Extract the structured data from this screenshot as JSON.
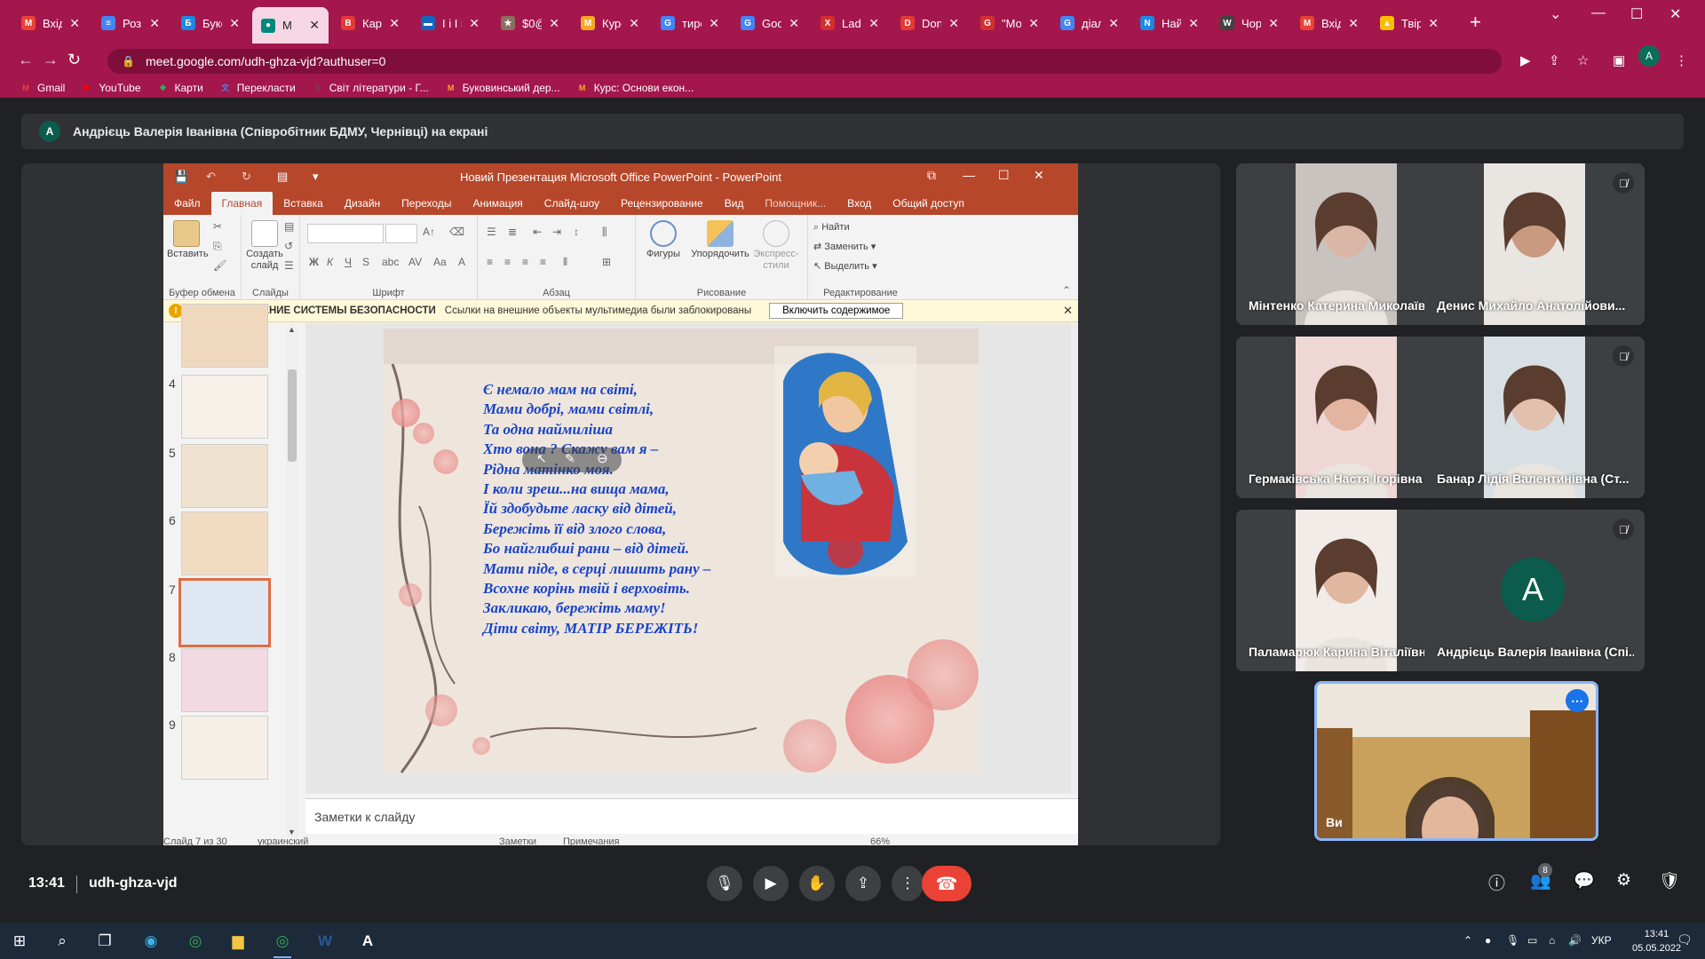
{
  "browser": {
    "tabs": [
      {
        "title": "Вхід",
        "color": "#ea4335",
        "glyph": "M"
      },
      {
        "title": "Розк",
        "color": "#4285f4",
        "glyph": "≡"
      },
      {
        "title": "Буко",
        "color": "#1e88e5",
        "glyph": "Б"
      },
      {
        "title": "M",
        "color": "#00897b",
        "glyph": "●",
        "active": true
      },
      {
        "title": "Карт",
        "color": "#e53935",
        "glyph": "В"
      },
      {
        "title": "І і І і",
        "color": "#1565c0",
        "glyph": "▬"
      },
      {
        "title": "$0@",
        "color": "#8d6e63",
        "glyph": "★"
      },
      {
        "title": "Курс",
        "color": "#f9a825",
        "glyph": "M"
      },
      {
        "title": "тире",
        "color": "#4285f4",
        "glyph": "G"
      },
      {
        "title": "Goo",
        "color": "#4285f4",
        "glyph": "G"
      },
      {
        "title": "Lady",
        "color": "#d32f2f",
        "glyph": "X"
      },
      {
        "title": "Don",
        "color": "#e53935",
        "glyph": "D"
      },
      {
        "title": "\"Мо",
        "color": "#d32f2f",
        "glyph": "G"
      },
      {
        "title": "діал",
        "color": "#4285f4",
        "glyph": "G"
      },
      {
        "title": "Найі",
        "color": "#1e88e5",
        "glyph": "N"
      },
      {
        "title": "Чорі",
        "color": "#424242",
        "glyph": "W"
      },
      {
        "title": "Вхід",
        "color": "#ea4335",
        "glyph": "M"
      },
      {
        "title": "Твір",
        "color": "#fbbc04",
        "glyph": "▲"
      }
    ],
    "new_tab": "+",
    "url": "meet.google.com/udh-ghza-vjd?authuser=0",
    "profile_initial": "A",
    "bookmarks": [
      {
        "label": "Gmail",
        "color": "#ea4335",
        "glyph": "M"
      },
      {
        "label": "YouTube",
        "color": "#ff0000",
        "glyph": "▶"
      },
      {
        "label": "Карти",
        "color": "#34a853",
        "glyph": "◆"
      },
      {
        "label": "Перекласти",
        "color": "#4285f4",
        "glyph": "文"
      },
      {
        "label": "Світ літератури - Г...",
        "color": "#6d4c41",
        "glyph": "Σ"
      },
      {
        "label": "Буковинський дер...",
        "color": "#f9a825",
        "glyph": "M"
      },
      {
        "label": "Курс: Основи екон...",
        "color": "#f9a825",
        "glyph": "M"
      }
    ]
  },
  "meet": {
    "presenter_initial": "A",
    "presenter_banner": "Андрієць Валерія Іванівна (Співробітник БДМУ, Чернівці) на екрані",
    "time": "13:41",
    "meeting_code": "udh-ghza-vjd",
    "participants_count": "8",
    "participants": [
      {
        "name": "Мінтенко Катерина Миколаїв...",
        "skin": "#d9b6a6",
        "bg": "#c9c3bf"
      },
      {
        "name": "Денис Михайло Анатолійови...",
        "skin": "#c99a80",
        "bg": "#e9e6e2"
      },
      {
        "name": "Гермаківська Настя Ігорівна (...",
        "skin": "#e3b49f",
        "bg": "#efd7d6"
      },
      {
        "name": "Банар Лідія Валентинівна (Ст...",
        "skin": "#e2c0ae",
        "bg": "#d8e0e4"
      },
      {
        "name": "Паламарюк Карина Віталіївн...",
        "skin": "#e0b7a0",
        "bg": "#f1ece8"
      },
      {
        "name": "Андрієць Валерія Іванівна (Спі...",
        "initial": "A"
      }
    ],
    "self_label": "Ви",
    "self_more": "⋯"
  },
  "ppt": {
    "title": "Новий Презентация Microsoft Office PowerPoint - PowerPoint",
    "menu": [
      "Файл",
      "Главная",
      "Вставка",
      "Дизайн",
      "Переходы",
      "Анимация",
      "Слайд-шоу",
      "Рецензирование",
      "Вид"
    ],
    "active_menu": "Главная",
    "helper": "Помощник...",
    "signin": "Вход",
    "share": "Общий доступ",
    "ribbon": {
      "paste": "Вставить",
      "new_slide": "Создать слайд",
      "shapes": "Фигуры",
      "arrange": "Упорядочить",
      "express": "Экспресс-стили",
      "find": "Найти",
      "replace": "Заменить",
      "select": "Выделить",
      "groups": [
        "Буфер обмена",
        "Слайды",
        "Шрифт",
        "Абзац",
        "Рисование",
        "Редактирование"
      ]
    },
    "security": {
      "title": "ПРЕДУПРЕЖДЕНИЕ СИСТЕМЫ БЕЗОПАСНОСТИ",
      "message": "Ссылки на внешние объекты мультимедиа были заблокированы",
      "button": "Включить содержимое"
    },
    "thumbnails": [
      "4",
      "5",
      "6",
      "7",
      "8",
      "9"
    ],
    "selected_slide": "7",
    "poem": [
      "Є немало мам на світі,",
      "Мами добрі, мами світлі,",
      "Та одна наймиліша",
      "Хто вона ? Скажу вам я –",
      "Рідна матінко моя.",
      "І коли зреш...на вища мама,",
      "Їй здобудьте ласку від дітей,",
      "Бережіть її від злого слова,",
      "Бо найглибші рани – від дітей.",
      "Мати піде, в серці лишить рану –",
      "Всохне корінь твій і верховіть.",
      "Закликаю, бережіть маму!",
      "Діти світу, МАТІР БЕРЕЖІТЬ!"
    ],
    "notes_placeholder": "Заметки к слайду",
    "status": {
      "slide_of": "Слайд 7 из 30",
      "lang": "украинский",
      "notes": "Заметки",
      "comments": "Примечания",
      "zoom": "66%"
    }
  },
  "taskbar": {
    "lang": "УКР",
    "time": "13:41",
    "date": "05.05.2022"
  }
}
